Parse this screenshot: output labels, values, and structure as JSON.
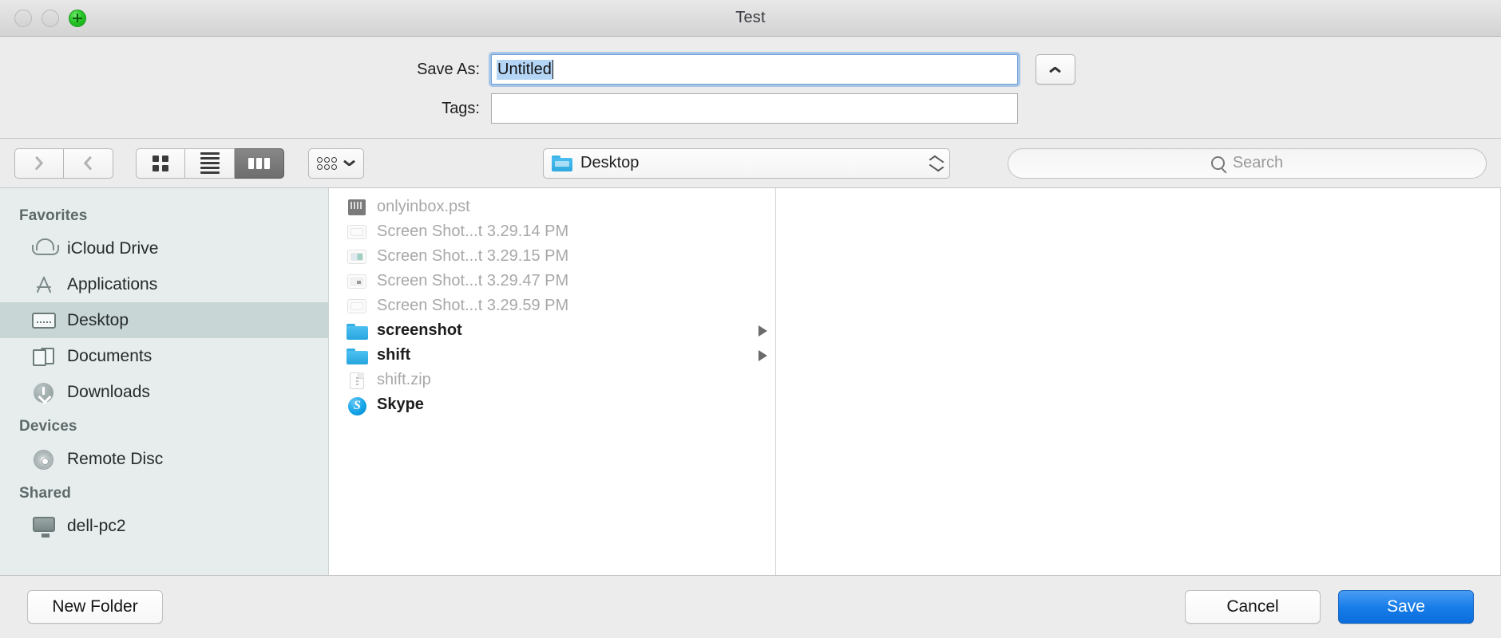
{
  "window": {
    "title": "Test",
    "traffic_lights": [
      {
        "name": "close",
        "state": "disabled"
      },
      {
        "name": "minimize",
        "state": "disabled"
      },
      {
        "name": "zoom",
        "state": "active-green-plus"
      }
    ]
  },
  "form": {
    "save_as_label": "Save As:",
    "save_as_value": "Untitled",
    "save_as_selected": true,
    "tags_label": "Tags:",
    "tags_value": "",
    "disclosure_icon": "chevron-up-icon"
  },
  "toolbar": {
    "back_icon": "chevron-left-icon",
    "forward_icon": "chevron-right-icon",
    "view_modes": [
      {
        "name": "icon-view",
        "icon": "grid-icon",
        "active": false
      },
      {
        "name": "list-view",
        "icon": "list-icon",
        "active": false
      },
      {
        "name": "column-view",
        "icon": "columns-icon",
        "active": true
      }
    ],
    "arrange_icon": "arrange-dots-icon",
    "arrange_chevron": "chevron-down-icon",
    "path_label": "Desktop",
    "path_icon": "blue-folder-icon",
    "path_chevrons": "up-down-chevron-icon",
    "search_icon": "search-icon",
    "search_placeholder": "Search",
    "search_value": ""
  },
  "sidebar": {
    "sections": [
      {
        "heading": "Favorites",
        "items": [
          {
            "label": "iCloud Drive",
            "icon": "cloud-icon",
            "selected": false
          },
          {
            "label": "Applications",
            "icon": "applications-icon",
            "selected": false
          },
          {
            "label": "Desktop",
            "icon": "desktop-icon",
            "selected": true
          },
          {
            "label": "Documents",
            "icon": "documents-icon",
            "selected": false
          },
          {
            "label": "Downloads",
            "icon": "downloads-icon",
            "selected": false
          }
        ]
      },
      {
        "heading": "Devices",
        "items": [
          {
            "label": "Remote Disc",
            "icon": "disc-icon",
            "selected": false
          }
        ]
      },
      {
        "heading": "Shared",
        "items": [
          {
            "label": "dell-pc2",
            "icon": "computer-icon",
            "selected": false
          }
        ]
      }
    ]
  },
  "file_list": {
    "items": [
      {
        "name": "onlyinbox.pst",
        "icon": "pst-file-icon",
        "enabled": false,
        "has_arrow": false
      },
      {
        "name": "Screen Shot...t 3.29.14 PM",
        "icon": "screenshot-thumb-icon",
        "enabled": false,
        "has_arrow": false
      },
      {
        "name": "Screen Shot...t 3.29.15 PM",
        "icon": "screenshot-thumb-icon",
        "enabled": false,
        "has_arrow": false
      },
      {
        "name": "Screen Shot...t 3.29.47 PM",
        "icon": "screenshot-thumb-icon",
        "enabled": false,
        "has_arrow": false
      },
      {
        "name": "Screen Shot...t 3.29.59 PM",
        "icon": "screenshot-thumb-icon",
        "enabled": false,
        "has_arrow": false
      },
      {
        "name": "screenshot",
        "icon": "blue-folder-icon",
        "enabled": true,
        "has_arrow": true
      },
      {
        "name": "shift",
        "icon": "blue-folder-icon",
        "enabled": true,
        "has_arrow": true
      },
      {
        "name": "shift.zip",
        "icon": "zip-file-icon",
        "enabled": false,
        "has_arrow": false
      },
      {
        "name": "Skype",
        "icon": "skype-app-icon",
        "enabled": true,
        "has_arrow": false
      }
    ]
  },
  "footer": {
    "new_folder_label": "New Folder",
    "cancel_label": "Cancel",
    "save_label": "Save"
  },
  "colors": {
    "accent_blue": "#177de8",
    "selection_blue": "#b4d5f5",
    "sidebar_bg": "#e7eded",
    "sidebar_selected": "#c9d6d6",
    "folder_blue": "#35b0e6",
    "chrome_gray": "#ececec"
  }
}
